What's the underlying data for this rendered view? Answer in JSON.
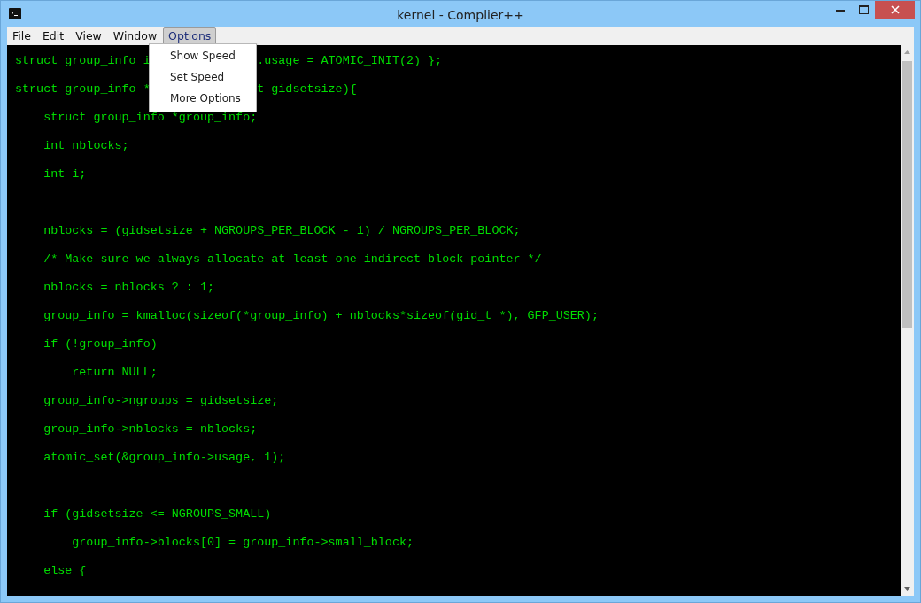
{
  "window": {
    "title": "kernel - Complier++"
  },
  "menu_bar": [
    {
      "label": "File",
      "selected": false
    },
    {
      "label": "Edit",
      "selected": false
    },
    {
      "label": "View",
      "selected": false
    },
    {
      "label": "Window",
      "selected": false
    },
    {
      "label": "Options",
      "selected": true
    }
  ],
  "dropdown": [
    "Show Speed",
    "Set Speed",
    "More Options"
  ],
  "code_lines": [
    {
      "kind": "covered",
      "parts": [
        "struct group_info i",
        ".usage = ATOMIC_INIT(2) };"
      ]
    },
    {
      "kind": "covered",
      "parts": [
        "struct group_info *",
        "t gidsetsize){"
      ]
    },
    {
      "kind": "code",
      "text": "    struct group_info *group_info;"
    },
    {
      "kind": "code",
      "text": "    int nblocks;"
    },
    {
      "kind": "code",
      "text": "    int i;"
    },
    {
      "kind": "blank"
    },
    {
      "kind": "code",
      "text": "    nblocks = (gidsetsize + NGROUPS_PER_BLOCK - 1) / NGROUPS_PER_BLOCK;"
    },
    {
      "kind": "code",
      "text": "    /* Make sure we always allocate at least one indirect block pointer */"
    },
    {
      "kind": "code",
      "text": "    nblocks = nblocks ? : 1;"
    },
    {
      "kind": "code",
      "text": "    group_info = kmalloc(sizeof(*group_info) + nblocks*sizeof(gid_t *), GFP_USER);"
    },
    {
      "kind": "code",
      "text": "    if (!group_info)"
    },
    {
      "kind": "code",
      "text": "        return NULL;"
    },
    {
      "kind": "code",
      "text": "    group_info->ngroups = gidsetsize;"
    },
    {
      "kind": "code",
      "text": "    group_info->nblocks = nblocks;"
    },
    {
      "kind": "code",
      "text": "    atomic_set(&group_info->usage, 1);"
    },
    {
      "kind": "blank"
    },
    {
      "kind": "code",
      "text": "    if (gidsetsize <= NGROUPS_SMALL)"
    },
    {
      "kind": "code",
      "text": "        group_info->blocks[0] = group_info->small_block;"
    },
    {
      "kind": "code",
      "text": "    else {"
    }
  ]
}
